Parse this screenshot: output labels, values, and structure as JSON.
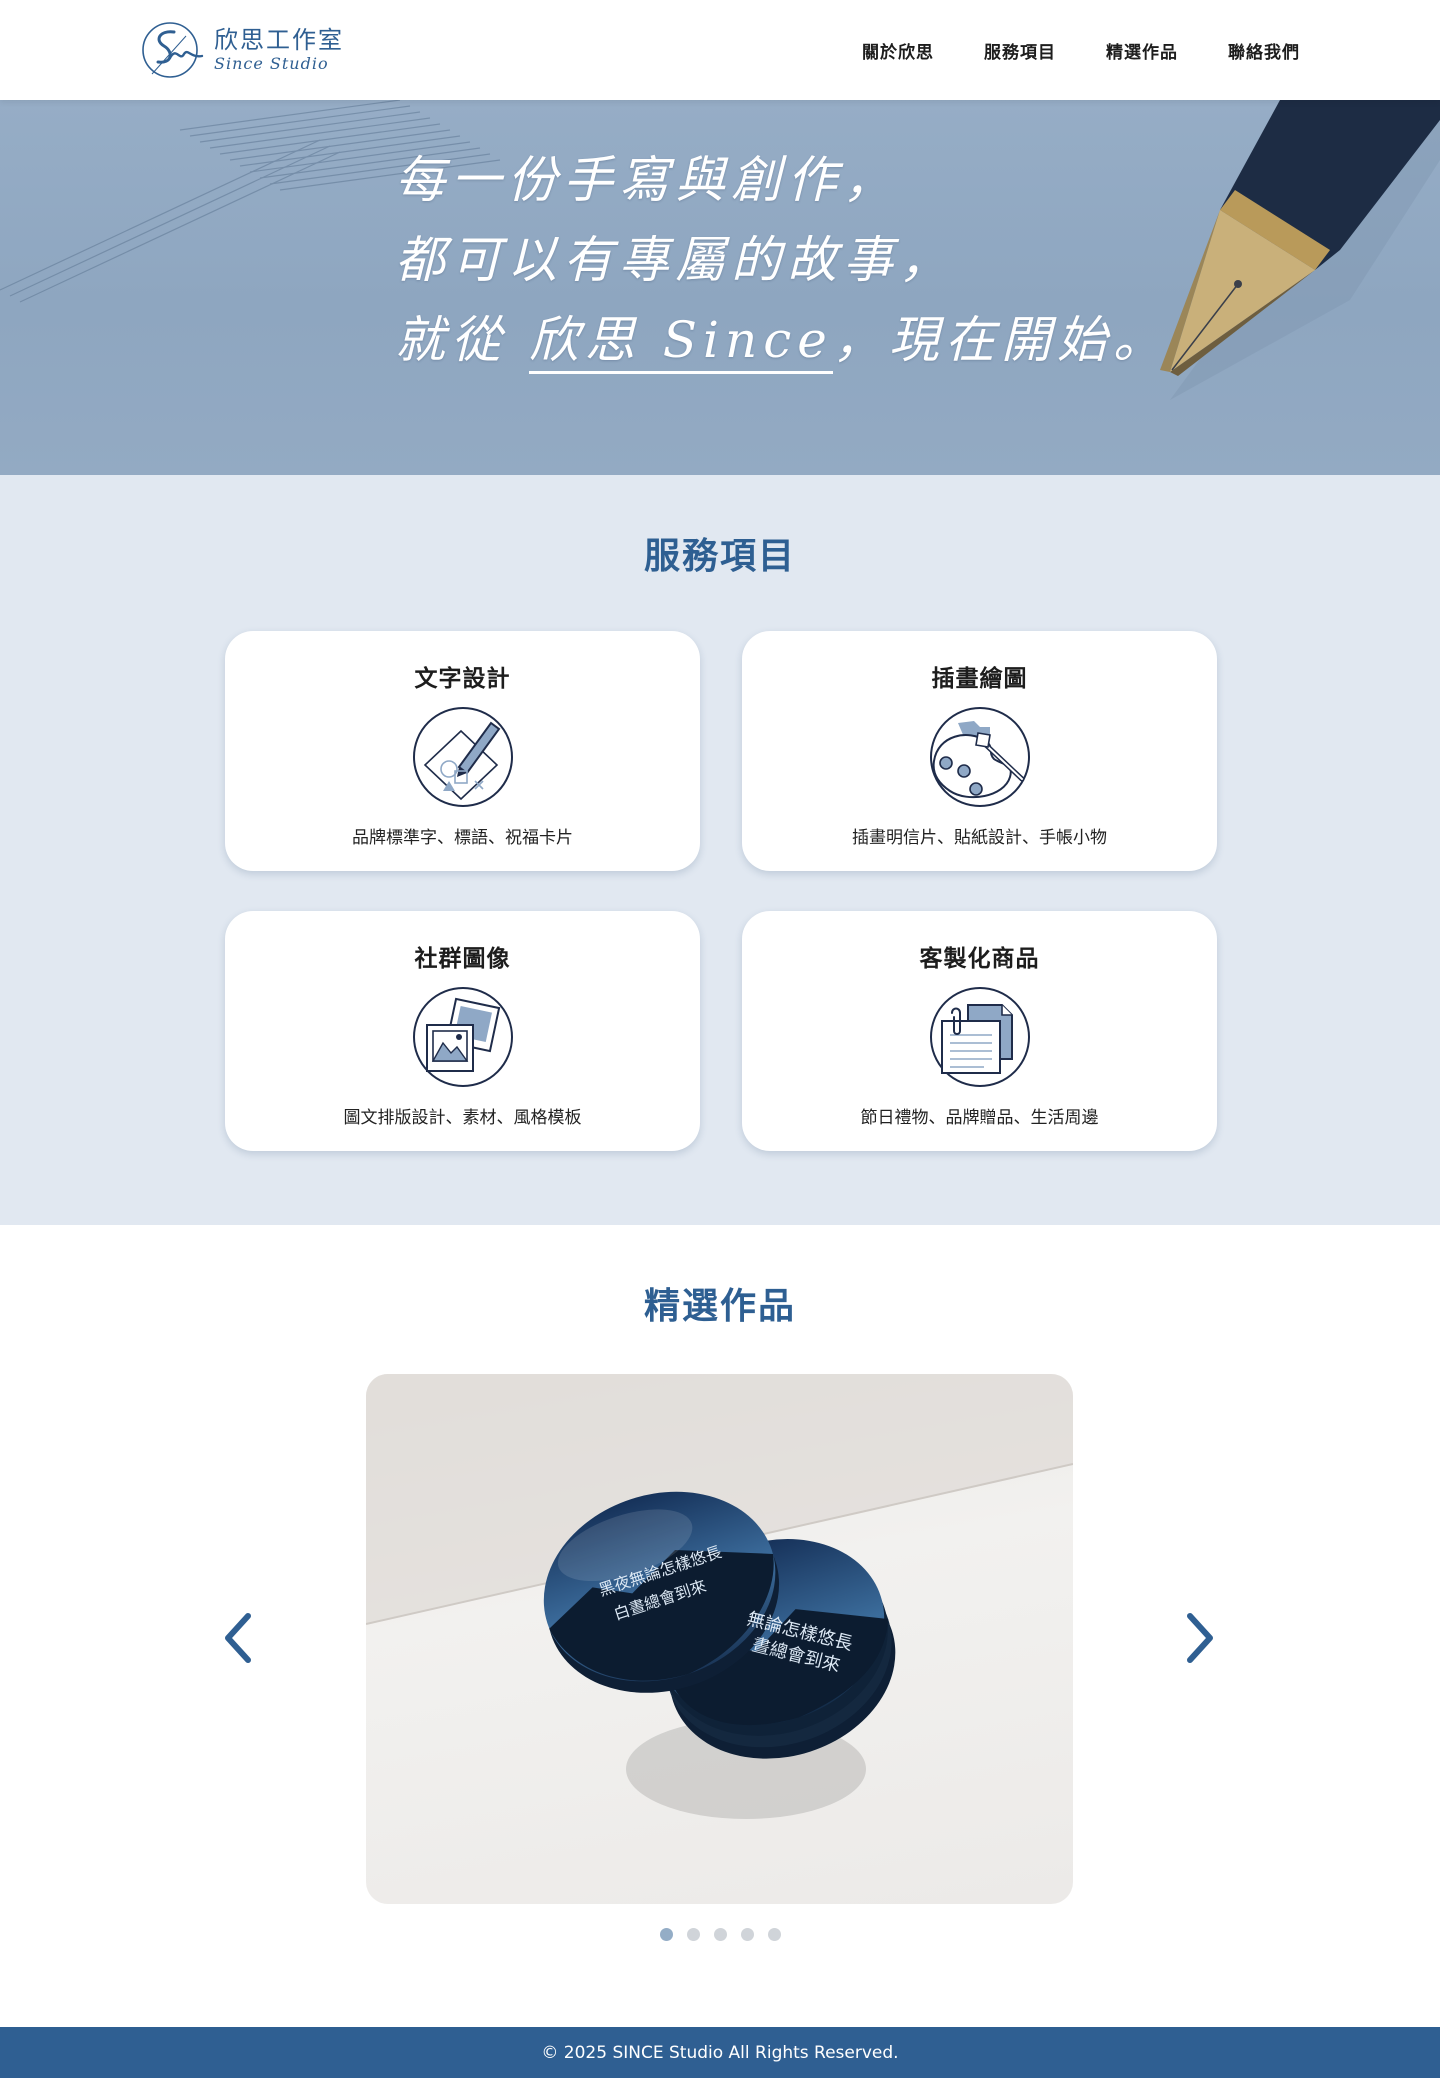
{
  "header": {
    "logo": {
      "cn": "欣思工作室",
      "en": "Since Studio"
    },
    "nav": [
      {
        "label": "關於欣思"
      },
      {
        "label": "服務項目"
      },
      {
        "label": "精選作品"
      },
      {
        "label": "聯絡我們"
      }
    ]
  },
  "hero": {
    "line1": "每一份手寫與創作，",
    "line2": "都可以有專屬的故事，",
    "line3_prefix": "就從",
    "line3_brand": "欣思 Since",
    "line3_suffix": "，現在開始。"
  },
  "services": {
    "title": "服務項目",
    "cards": [
      {
        "title": "文字設計",
        "icon": "pen-shapes-icon",
        "desc": "品牌標準字、標語、祝福卡片"
      },
      {
        "title": "插畫繪圖",
        "icon": "palette-brush-icon",
        "desc": "插畫明信片、貼紙設計、手帳小物"
      },
      {
        "title": "社群圖像",
        "icon": "photo-frames-icon",
        "desc": "圖文排版設計、素材、風格模板"
      },
      {
        "title": "客製化商品",
        "icon": "documents-icon",
        "desc": "節日禮物、品牌贈品、生活周邊"
      }
    ]
  },
  "works": {
    "title": "精選作品",
    "slide": {
      "coaster_text_line1": "黑夜無論怎樣悠長",
      "coaster_text_line2": "白晝總會到來",
      "coaster2_text_line1": "無論怎樣悠長",
      "coaster2_text_line2": "晝總會到來"
    },
    "slide_count": 5,
    "active_slide": 1
  },
  "footer": {
    "copyright": "© 2025  SINCE Studio All Rights Reserved."
  },
  "colors": {
    "brand_blue": "#2f5f92",
    "hero_bg": "#93aac3",
    "services_bg": "#e1e8f1"
  }
}
